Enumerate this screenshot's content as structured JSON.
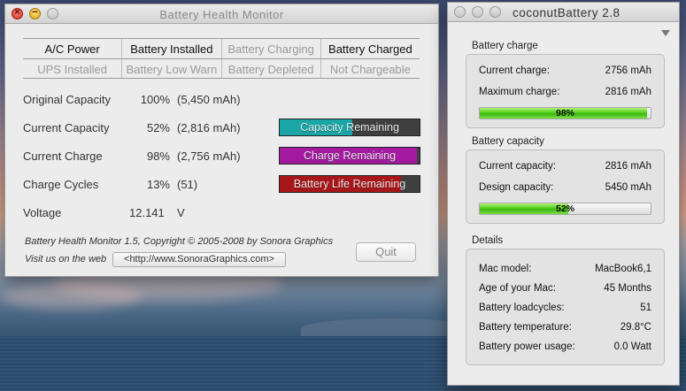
{
  "bhm": {
    "title": "Battery Health Monitor",
    "status_rows": [
      [
        {
          "label": "A/C Power",
          "on": true
        },
        {
          "label": "Battery Installed",
          "on": true
        },
        {
          "label": "Battery Charging",
          "on": false
        },
        {
          "label": "Battery Charged",
          "on": true
        }
      ],
      [
        {
          "label": "UPS Installed",
          "on": false
        },
        {
          "label": "Battery Low Warn",
          "on": false
        },
        {
          "label": "Battery Depleted",
          "on": false
        },
        {
          "label": "Not Chargeable",
          "on": false
        }
      ]
    ],
    "metrics": {
      "original_capacity": {
        "label": "Original Capacity",
        "pct": "100%",
        "detail": "(5,450 mAh)"
      },
      "current_capacity": {
        "label": "Current Capacity",
        "pct": "52%",
        "detail": "(2,816 mAh)",
        "bar_label": "Capacity Remaining",
        "fill": 0.52,
        "color": "#1aa6a6"
      },
      "current_charge": {
        "label": "Current Charge",
        "pct": "98%",
        "detail": "(2,756 mAh)",
        "bar_label": "Charge Remaining",
        "fill": 0.98,
        "color": "#a31aa0"
      },
      "charge_cycles": {
        "label": "Charge Cycles",
        "pct": "13%",
        "detail": "(51)",
        "bar_label": "Battery Life Remaining",
        "fill": 0.87,
        "color": "#a8161a"
      },
      "voltage": {
        "label": "Voltage",
        "value": "12.141",
        "unit": "V"
      }
    },
    "copyright": "Battery Health Monitor 1.5, Copyright © 2005-2008 by Sonora Graphics",
    "visit_label": "Visit us on the web",
    "url_button": "<http://www.SonoraGraphics.com>",
    "quit_label": "Quit"
  },
  "cb": {
    "title": "coconutBattery 2.8",
    "battery_charge": {
      "section": "Battery charge",
      "current_label": "Current charge:",
      "current_value": "2756 mAh",
      "max_label": "Maximum charge:",
      "max_value": "2816 mAh",
      "percent": "98%",
      "fill": 0.98
    },
    "battery_capacity": {
      "section": "Battery capacity",
      "current_label": "Current capacity:",
      "current_value": "2816 mAh",
      "design_label": "Design capacity:",
      "design_value": "5450 mAh",
      "percent": "52%",
      "fill": 0.52
    },
    "details": {
      "section": "Details",
      "rows": [
        {
          "label": "Mac model:",
          "value": "MacBook6,1"
        },
        {
          "label": "Age of your Mac:",
          "value": "45 Months"
        },
        {
          "label": "Battery loadcycles:",
          "value": "51"
        },
        {
          "label": "Battery temperature:",
          "value": "29.8°C"
        },
        {
          "label": "Battery power usage:",
          "value": "0.0 Watt"
        }
      ]
    }
  }
}
